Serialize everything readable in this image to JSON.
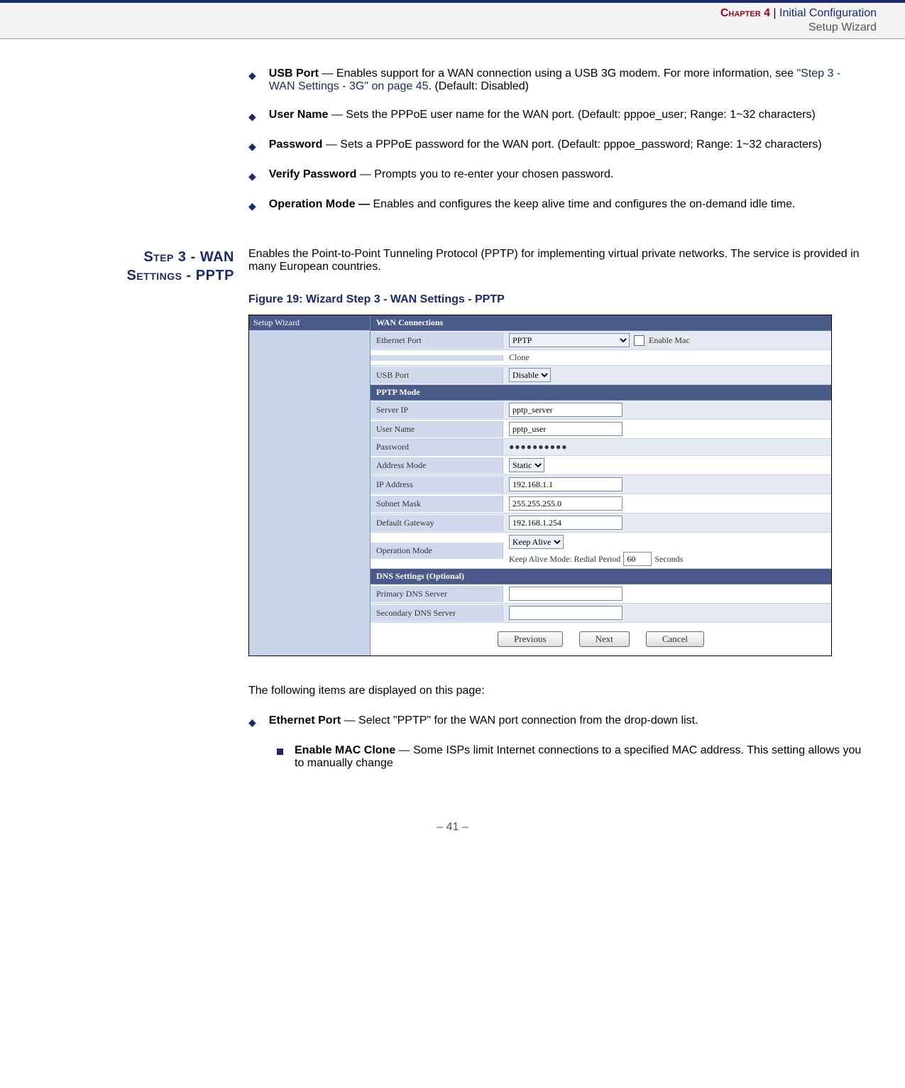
{
  "header": {
    "chapter": "Chapter 4",
    "sep": "  |  ",
    "title": "Initial Configuration",
    "subtitle": "Setup Wizard"
  },
  "bul": [
    {
      "b": "USB Port",
      "t": " — Enables support for a WAN connection using a USB 3G modem. For more information, see ",
      "link": "\"Step 3 - WAN Settings - 3G\" on page 45",
      "tail": ". (Default: Disabled)"
    },
    {
      "b": "User Name",
      "t": " — Sets the PPPoE user name for the WAN port. (Default: pppoe_user; Range: 1~32 characters)"
    },
    {
      "b": "Password",
      "t": " — Sets a PPPoE password for the WAN port. (Default: pppoe_password; Range: 1~32 characters)"
    },
    {
      "b": "Verify Password",
      "t": " — Prompts you to re-enter your chosen password."
    },
    {
      "b": "Operation Mode —",
      "t": " Enables and configures the keep alive time and configures the on-demand idle time."
    }
  ],
  "section": {
    "label1": "Step 3 - WAN",
    "label2": "Settings - PPTP",
    "intro": "Enables the Point-to-Point Tunneling Protocol (PPTP) for implementing virtual private networks. The service is provided in many European countries."
  },
  "fig": {
    "caption": "Figure 19:  Wizard Step 3 - WAN Settings - PPTP",
    "side": "Setup Wizard",
    "h1": "WAN Connections",
    "h2": "PPTP Mode",
    "h3": "DNS Settings (Optional)",
    "ethLabel": "Ethernet Port",
    "ethSel": "PPTP",
    "enableMac": "Enable Mac",
    "clone": "Clone",
    "usbLabel": "USB Port",
    "usbSel": "Disable",
    "serverIP": "Server IP",
    "serverIPv": "pptp_server",
    "userName": "User Name",
    "userNamev": "pptp_user",
    "password": "Password",
    "passwordv": "●●●●●●●●●●",
    "addrMode": "Address Mode",
    "addrModev": "Static",
    "ip": "IP Address",
    "ipv": "192.168.1.1",
    "subnet": "Subnet Mask",
    "subnetv": "255.255.255.0",
    "gw": "Default Gateway",
    "gwv": "192.168.1.254",
    "opMode": "Operation Mode",
    "opModev": "Keep Alive",
    "opModeLine": "Keep Alive Mode: Redial Period",
    "opModeNum": "60",
    "opModeSec": "Seconds",
    "dns1": "Primary DNS Server",
    "dns2": "Secondary DNS Server",
    "btnPrev": "Previous",
    "btnNext": "Next",
    "btnCancel": "Cancel"
  },
  "after": {
    "lead": "The following items are displayed on this page:",
    "b1": {
      "b": "Ethernet Port",
      "t": " — Select \"PPTP\" for the WAN port connection from the drop-down list."
    },
    "s1": {
      "b": "Enable MAC Clone",
      "t": " — Some ISPs limit Internet connections to a specified MAC address. This setting allows you to manually change"
    }
  },
  "footer": "–  41  –"
}
